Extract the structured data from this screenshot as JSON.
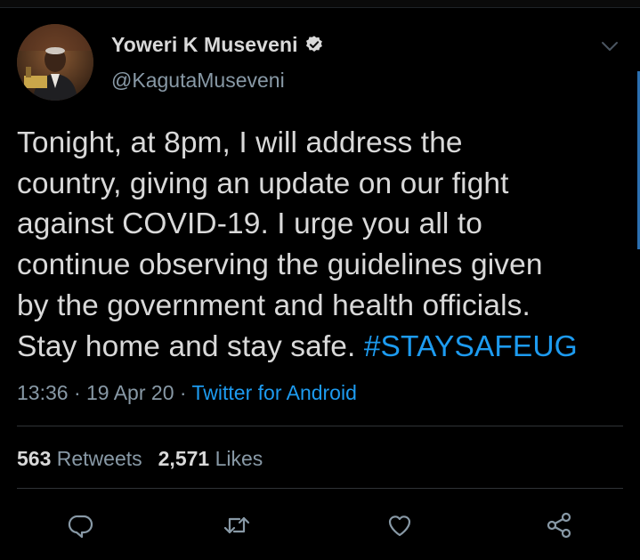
{
  "tweet": {
    "author": {
      "display_name": "Yoweri K Museveni",
      "handle": "@KagutaMuseveni",
      "verified": true
    },
    "text_lines": [
      "Tonight, at 8pm, I will address the",
      "country, giving an update on our fight",
      "against COVID-19. I urge you all to",
      "continue observing the guidelines given",
      "by the government and health officials.",
      "Stay home and stay safe. "
    ],
    "hashtag": "#STAYSAFEUG",
    "time": "13:36",
    "date": "19 Apr 20",
    "separator": " · ",
    "source": "Twitter for Android",
    "retweets_count": "563",
    "retweets_label": "Retweets",
    "likes_count": "2,571",
    "likes_label": "Likes"
  },
  "icons": {
    "verified": "verified-badge-icon",
    "more": "chevron-down-icon",
    "reply": "reply-icon",
    "retweet": "retweet-icon",
    "like": "heart-icon",
    "share": "share-icon"
  },
  "colors": {
    "background": "#000000",
    "text": "#d9d9d9",
    "muted": "#8899a6",
    "link": "#1d9bf0",
    "divider": "#2f3336"
  }
}
